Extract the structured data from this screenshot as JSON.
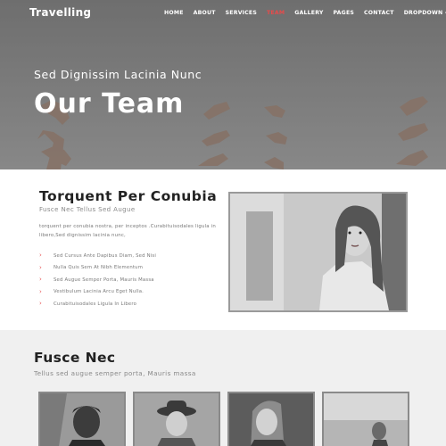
{
  "header": {
    "brand": "Travelling",
    "nav": [
      {
        "label": "HOME",
        "active": false
      },
      {
        "label": "ABOUT",
        "active": false
      },
      {
        "label": "SERVICES",
        "active": false
      },
      {
        "label": "TEAM",
        "active": true
      },
      {
        "label": "GALLERY",
        "active": false
      },
      {
        "label": "PAGES",
        "active": false
      },
      {
        "label": "CONTACT",
        "active": false
      },
      {
        "label": "DROPDOWN -",
        "active": false
      }
    ]
  },
  "hero": {
    "subtitle": "Sed Dignissim Lacinia Nunc",
    "title": "Our Team"
  },
  "about": {
    "title": "Torquent Per Conubia",
    "subtitle": "Fusce Nec Tellus Sed Augue",
    "paragraph": "torquent per conubia nostra, per inceptos .Curabituisodales ligula in libero,Sed dignissim lacinia nunc,",
    "list": [
      "Sed Cursus Ante Dapibus Diam, Sed Nisi",
      "Nulla Quis Sem At Nibh Elementum",
      "Sed Augue Semper Porta, Mauris Massa",
      "Vestibulum Lacinia Arcu Eget Nulla.",
      "Curabituisodales Ligula In Libero"
    ]
  },
  "team": {
    "title": "Fusce Nec",
    "subtitle": "Tellus sed augue semper porta, Mauris massa"
  },
  "colors": {
    "accent": "#e64b4b",
    "hero_bg": "#7a7a7a",
    "team_bg": "#f0f0f0"
  }
}
